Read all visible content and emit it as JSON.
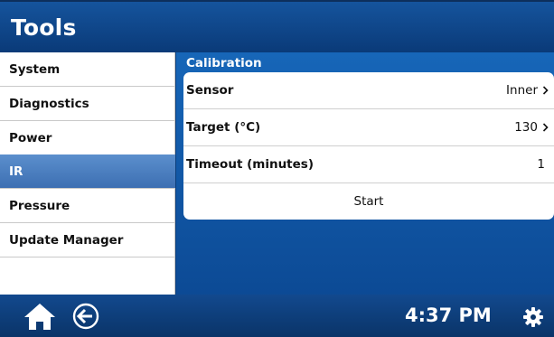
{
  "header": {
    "title": "Tools"
  },
  "sidebar": {
    "items": [
      {
        "label": "System"
      },
      {
        "label": "Diagnostics"
      },
      {
        "label": "Power"
      },
      {
        "label": "IR",
        "active": true
      },
      {
        "label": "Pressure"
      },
      {
        "label": "Update Manager"
      }
    ]
  },
  "calibration": {
    "title": "Calibration",
    "rows": [
      {
        "label": "Sensor",
        "value": "Inner"
      },
      {
        "label": "Target (°C)",
        "value": "130"
      },
      {
        "label": "Timeout (minutes)",
        "value": "1"
      }
    ],
    "start_label": "Start"
  },
  "footer": {
    "time": "4:37 PM",
    "icons": [
      "home-icon",
      "back-icon",
      "gear-icon"
    ]
  },
  "colors": {
    "header_blue": "#0a3a78",
    "active_item": "#4a7fc0",
    "content_blue": "#1766b8",
    "footer_blue": "#0a3468"
  }
}
